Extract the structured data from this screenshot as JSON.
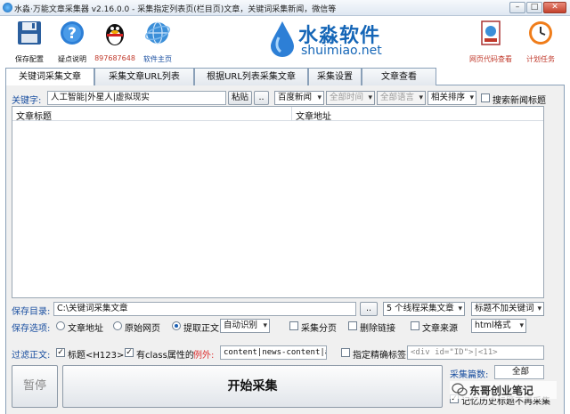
{
  "window": {
    "title": "水淼·万能文章采集器 v2.16.0.0 - 采集指定列表页(栏目页)文章，关键词采集新闻，微信等",
    "buttons": {
      "minimize": "–",
      "maximize": "□",
      "close": "✕"
    }
  },
  "toolbar": {
    "save": "保存配置",
    "help": "疑点说明",
    "qq": "897687648",
    "home": "软件主页",
    "code_view": "网页代码查看",
    "plan": "计划任务"
  },
  "logo": {
    "cn": "水淼软件",
    "en": "shuimiao.net"
  },
  "tabs": [
    "关键词采集文章",
    "采集文章URL列表",
    "根据URL列表采集文章",
    "采集设置",
    "文章查看"
  ],
  "search": {
    "label": "关键字:",
    "value": "人工智能|外星人|虚拟现实",
    "paste": "粘贴",
    "more": "..",
    "engine": "百度新闻",
    "time": "全部时间",
    "lang": "全部语言",
    "sort": "相关排序",
    "news_title": "搜索新闻标题"
  },
  "list": {
    "col_title": "文章标题",
    "col_url": "文章地址"
  },
  "save_dir": {
    "label": "保存目录:",
    "value": "C:\\关键词采集文章",
    "more": "..",
    "threads": "5 个线程采集文章",
    "title_mode": "标题不加关键词"
  },
  "save_opts": {
    "label": "保存选项:",
    "addr": "文章地址",
    "orig": "原始网页",
    "extract": "提取正文",
    "auto": "自动识别",
    "paging": "采集分页",
    "del_links": "删除链接",
    "source": "文章来源",
    "format": "html格式"
  },
  "filter": {
    "label": "过滤正文:",
    "title": "标题<H123>",
    "class_attr": "有class属性的",
    "except": "例外:",
    "classes": "content|news-content|abs",
    "precise": "指定精确标签",
    "precise_value": "<div id=\"ID\">|<11>"
  },
  "bottom": {
    "pause": "暂停",
    "start": "开始采集",
    "count_label": "采集篇数:",
    "count": "全部",
    "history": "记忆历史标题不再采集",
    "watermark": "东哥创业笔记"
  }
}
